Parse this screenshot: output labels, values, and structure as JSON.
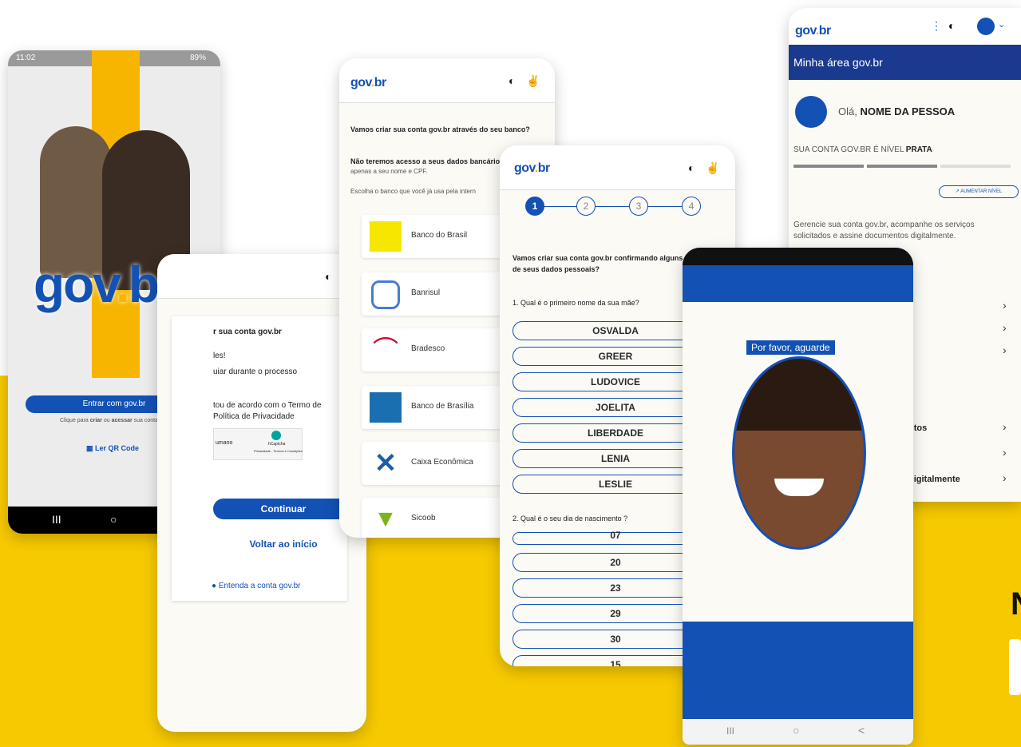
{
  "brand": {
    "g": "gov",
    "dot": ".",
    "br": "br",
    "colors": {
      "blue": "#1351b4",
      "yellow": "#f7c900",
      "green": "#168821"
    }
  },
  "phone1": {
    "status_time": "11:02",
    "status_battery": "89%",
    "logo_gov": "gov",
    "logo_dot": ".",
    "logo_br": "br",
    "login_button": "Entrar com gov.br",
    "hint_prefix": "Clique para ",
    "hint_create": "criar",
    "hint_mid": " ou ",
    "hint_access": "acessar",
    "hint_suffix": " sua conta gov.br",
    "qr_label": "Ler QR Code",
    "nav": [
      "III",
      "○",
      "<"
    ]
  },
  "screen2": {
    "title_fragment": "r sua conta gov.br",
    "line2": "les!",
    "line3": "uiar durante o processo",
    "terms_l1": "tou de acordo com o Termo de",
    "terms_l2": "Política de Privacidade",
    "captcha_human": "umano",
    "captcha_name": "hCaptcha",
    "captcha_sub": "Privacidade - Termos e Condições",
    "continue": "Continuar",
    "back": "Voltar ao início",
    "understand": "Entenda a conta gov.br"
  },
  "screen3": {
    "heading": "Vamos criar sua conta gov.br através do seu banco?",
    "subheading": "Não teremos acesso a seus dados bancário",
    "sub2": "apenas a seu nome e CPF.",
    "choose": "Escolha o banco que você já usa pela intern",
    "banks": [
      "Banco do Brasil",
      "Banrisul",
      "Bradesco",
      "Banco de Brasília",
      "Caixa Econômica",
      "Sicoob"
    ]
  },
  "screen4": {
    "steps": [
      "1",
      "2",
      "3",
      "4"
    ],
    "intro_l1": "Vamos criar sua conta gov.br confirmando alguns",
    "intro_l2": "de seus dados pessoais?",
    "q1": "1. Qual é o primeiro nome da sua mãe?",
    "names": [
      "OSVALDA",
      "GREER",
      "LUDOVICE",
      "JOELITA",
      "LIBERDADE",
      "LENIA",
      "LESLIE"
    ],
    "q2": "2. Qual é o seu dia de nascimento ?",
    "days": [
      "07",
      "20",
      "23",
      "29",
      "30",
      "15"
    ]
  },
  "screen5": {
    "area_title": "Minha área gov.br",
    "greeting": "Olá, ",
    "name": "NOME DA PESSOA",
    "level_prefix": "SUA CONTA GOV.BR É NÍVEL ",
    "level": "PRATA",
    "raise_button": "AUMENTAR NÍVEL",
    "manage_l1": "Gerencie sua conta gov.br, acompanhe os serviços",
    "manage_l2": "solicitados e assine documentos digitalmente.",
    "menu_fragments": [
      "ntos",
      "",
      "digitalmente"
    ]
  },
  "screen6": {
    "wait": "Por favor, aguarde",
    "nav": [
      "III",
      "○",
      "<"
    ]
  },
  "edge_letter": "N"
}
